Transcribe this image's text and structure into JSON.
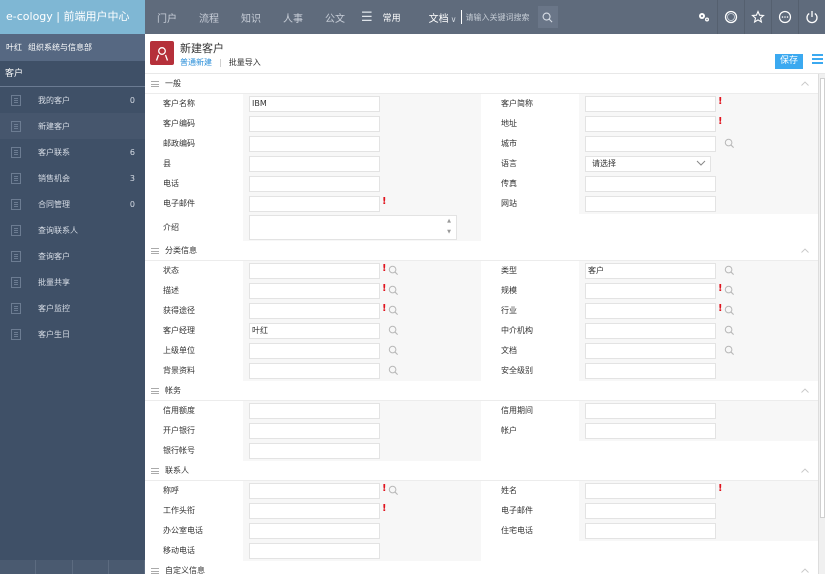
{
  "app": {
    "brand": "e-cology | 前端用户中心"
  },
  "topnav": {
    "items": [
      "门户",
      "流程",
      "知识",
      "人事",
      "公文"
    ],
    "menu_icon": "hamburger-icon",
    "common": "常用",
    "search_type": "文档",
    "search_placeholder": "请输入关键词搜索",
    "right_icons": [
      "gears-icon",
      "face-icon",
      "star-icon",
      "more-icon",
      "power-icon"
    ]
  },
  "user": {
    "name": "叶红",
    "dept": "组织系统与信息部"
  },
  "sidebar": {
    "heading": "客户",
    "items": [
      {
        "label": "我的客户",
        "count": "0"
      },
      {
        "label": "新建客户",
        "count": ""
      },
      {
        "label": "客户联系",
        "count": "6"
      },
      {
        "label": "销售机会",
        "count": "3"
      },
      {
        "label": "合同管理",
        "count": "0"
      },
      {
        "label": "查询联系人",
        "count": ""
      },
      {
        "label": "查询客户",
        "count": ""
      },
      {
        "label": "批量共享",
        "count": ""
      },
      {
        "label": "客户监控",
        "count": ""
      },
      {
        "label": "客户生日",
        "count": ""
      }
    ],
    "active_index": 1
  },
  "page": {
    "title": "新建客户",
    "tabs": [
      "普通新建",
      "批量导入"
    ],
    "active_tab": 0,
    "save_label": "保存",
    "colors": {
      "accent": "#3ba9f0",
      "icon_bg": "#b5303a",
      "required": "#e0141e"
    }
  },
  "sections": {
    "general": {
      "title": "一般",
      "left": [
        {
          "label": "客户名称",
          "value": "IBM"
        },
        {
          "label": "客户编码",
          "value": ""
        },
        {
          "label": "邮政编码",
          "value": ""
        },
        {
          "label": "县",
          "value": ""
        },
        {
          "label": "电话",
          "value": ""
        },
        {
          "label": "电子邮件",
          "value": "",
          "required": true
        },
        {
          "label": "介绍",
          "value": ""
        }
      ],
      "right": [
        {
          "label": "客户简称",
          "value": "",
          "required": true
        },
        {
          "label": "地址",
          "value": "",
          "required": true
        },
        {
          "label": "城市",
          "value": "",
          "lookup": true
        },
        {
          "label": "语言",
          "value": "请选择"
        },
        {
          "label": "传真",
          "value": ""
        },
        {
          "label": "网站",
          "value": ""
        }
      ]
    },
    "category": {
      "title": "分类信息",
      "left": [
        {
          "label": "状态",
          "value": "",
          "required": true,
          "lookup": true
        },
        {
          "label": "描述",
          "value": "",
          "required": true,
          "lookup": true
        },
        {
          "label": "获得途径",
          "value": "",
          "required": true,
          "lookup": true
        },
        {
          "label": "客户经理",
          "value": "叶红",
          "lookup": true
        },
        {
          "label": "上级单位",
          "value": "",
          "lookup": true
        },
        {
          "label": "背景资料",
          "value": "",
          "lookup": true
        }
      ],
      "right": [
        {
          "label": "类型",
          "value": "客户",
          "lookup": true
        },
        {
          "label": "规模",
          "value": "",
          "required": true,
          "lookup": true
        },
        {
          "label": "行业",
          "value": "",
          "required": true,
          "lookup": true
        },
        {
          "label": "中介机构",
          "value": "",
          "lookup": true
        },
        {
          "label": "文档",
          "value": "",
          "lookup": true
        },
        {
          "label": "安全级别",
          "value": ""
        }
      ]
    },
    "finance": {
      "title": "帐务",
      "left": [
        {
          "label": "信用额度",
          "value": ""
        },
        {
          "label": "开户银行",
          "value": ""
        },
        {
          "label": "银行帐号",
          "value": ""
        }
      ],
      "right": [
        {
          "label": "信用期间",
          "value": ""
        },
        {
          "label": "帐户",
          "value": ""
        }
      ]
    },
    "contact": {
      "title": "联系人",
      "left": [
        {
          "label": "称呼",
          "value": "",
          "required": true,
          "lookup": true
        },
        {
          "label": "工作头衔",
          "value": "",
          "required": true
        },
        {
          "label": "办公室电话",
          "value": ""
        },
        {
          "label": "移动电话",
          "value": ""
        }
      ],
      "right": [
        {
          "label": "姓名",
          "value": "",
          "required": true
        },
        {
          "label": "电子邮件",
          "value": ""
        },
        {
          "label": "住宅电话",
          "value": ""
        }
      ]
    },
    "custom": {
      "title": "自定义信息"
    }
  }
}
